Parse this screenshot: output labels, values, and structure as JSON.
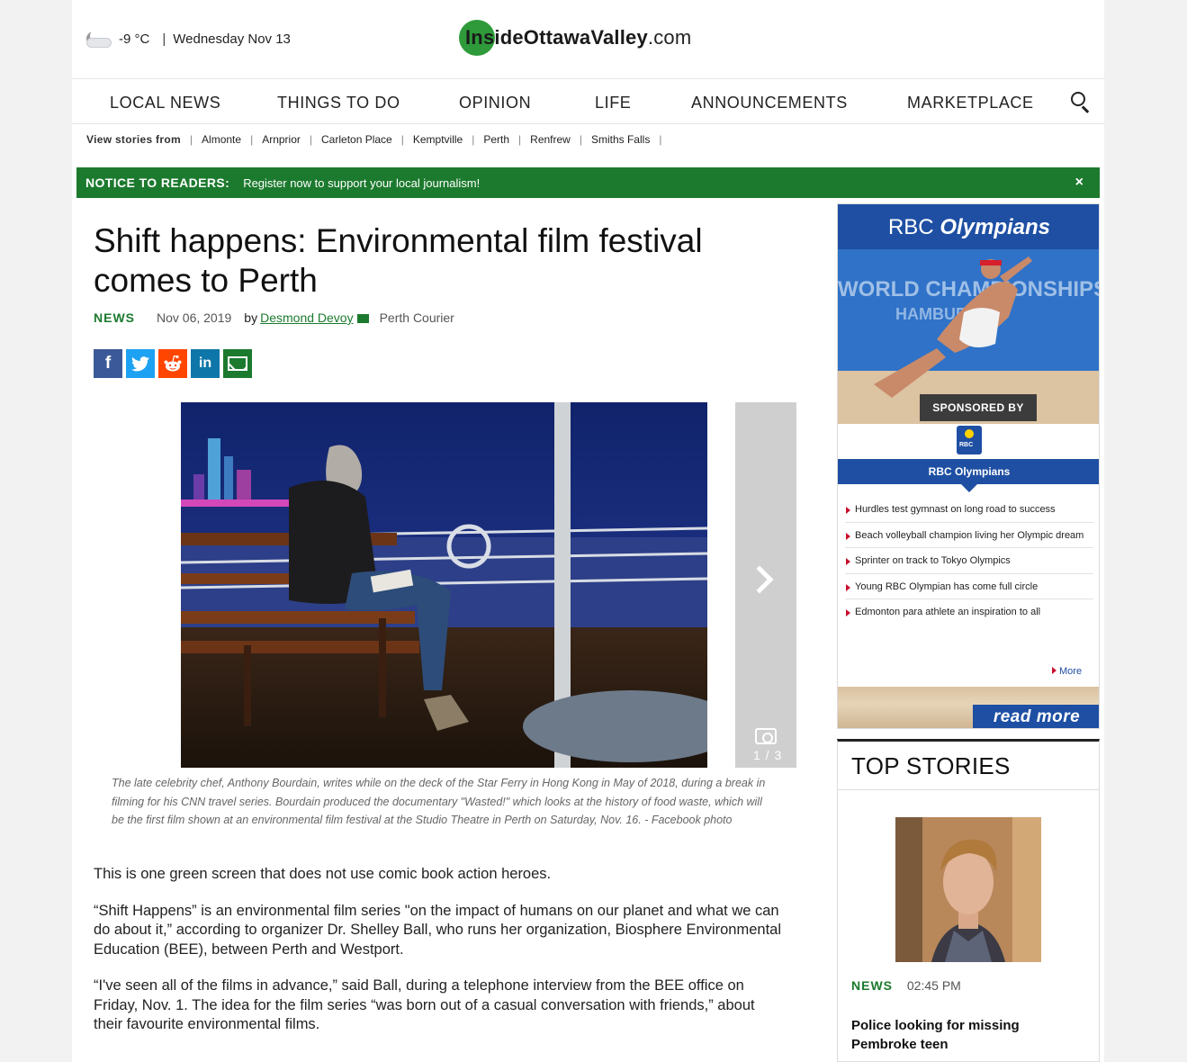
{
  "header": {
    "temperature": "-9 °C",
    "separator": "|",
    "date": "Wednesday Nov 13",
    "logo_main": "InsideOttawaValley",
    "logo_suffix": ".com"
  },
  "nav": {
    "items": [
      "LOCAL NEWS",
      "THINGS TO DO",
      "OPINION",
      "LIFE",
      "ANNOUNCEMENTS",
      "MARKETPLACE"
    ]
  },
  "stories_nav": {
    "lead": "View stories from",
    "towns": [
      "Almonte",
      "Arnprior",
      "Carleton Place",
      "Kemptville",
      "Perth",
      "Renfrew",
      "Smiths Falls"
    ]
  },
  "notice": {
    "label": "NOTICE TO READERS:",
    "message": "Register now to support your local journalism!",
    "close": "×"
  },
  "article": {
    "headline": "Shift happens: Environmental film festival comes to Perth",
    "section": "NEWS",
    "date": "Nov 06, 2019",
    "by": "by",
    "author": "Desmond Devoy",
    "publication": "Perth Courier",
    "gallery_count": "1 / 3",
    "caption": "The late celebrity chef, Anthony Bourdain, writes while on the deck of the Star Ferry in Hong Kong in May of 2018, during a break in filming for his CNN travel series. Bourdain produced the documentary \"Wasted!\" which looks at the history of food waste, which will be the first film shown at an environmental film festival at the Studio Theatre in Perth on Saturday, Nov. 16. - Facebook photo",
    "paragraphs": [
      "This is one green screen that does not use comic book action heroes.",
      "“Shift Happens” is an environmental film series \"on the impact of humans on our planet and what we can do about it,” according to organizer Dr. Shelley Ball, who runs her organization, Biosphere Environmental Education (BEE), between Perth and Westport.",
      "“I've seen all of the films in advance,” said Ball, during a telephone interview from the BEE office on Friday, Nov. 1. The idea for the film series “was born out of a casual conversation with friends,” about their favourite environmental films."
    ]
  },
  "ad": {
    "title_left": "RBC",
    "title_right": "Olympians",
    "sponsored": "SPONSORED BY",
    "band": "RBC Olympians",
    "items": [
      "Hurdles test gymnast on long road to success",
      "Beach volleyball champion living her Olympic dream",
      "Sprinter on track to Tokyo Olympics",
      "Young RBC Olympian has come full circle",
      "Edmonton para athlete an inspiration to all"
    ],
    "more": "More",
    "read_more": "read more"
  },
  "top_stories": {
    "title": "TOP STORIES",
    "section": "NEWS",
    "time": "02:45 PM",
    "headline": "Police looking for missing Pembroke teen"
  },
  "colors": {
    "brand_green": "#1c7a2e",
    "rbc_blue": "#1e4fa3"
  }
}
